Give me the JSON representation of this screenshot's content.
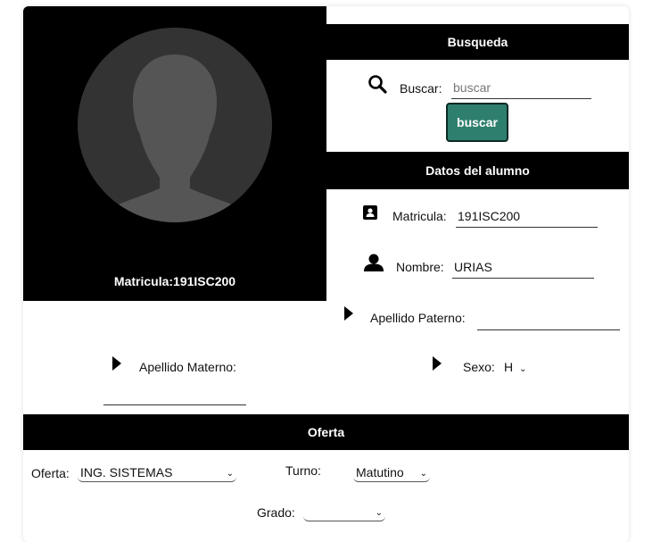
{
  "photo": {
    "caption_label": "Matricula:",
    "caption_value": "191ISC200",
    "avatar_bg": "#333333",
    "silhouette_color": "#555555"
  },
  "search": {
    "title": "Busqueda",
    "label": "Buscar:",
    "placeholder": "buscar",
    "button_label": "buscar",
    "icon": "search-icon",
    "button_color": "#2f7f6e"
  },
  "datos": {
    "title": "Datos del alumno",
    "matricula_label": "Matricula:",
    "matricula_value": "191ISC200",
    "nombre_label": "Nombre:",
    "nombre_value": "URIAS",
    "paterno_label": "Apellido Paterno:",
    "paterno_value": "",
    "materno_label": "Apellido Materno:",
    "materno_value": "",
    "sexo_label": "Sexo:",
    "sexo_value": "H"
  },
  "oferta": {
    "title": "Oferta",
    "oferta_label": "Oferta:",
    "oferta_value": "ING. SISTEMAS",
    "turno_label": "Turno:",
    "turno_value": "Matutino",
    "grado_label": "Grado:",
    "grado_value": ""
  }
}
